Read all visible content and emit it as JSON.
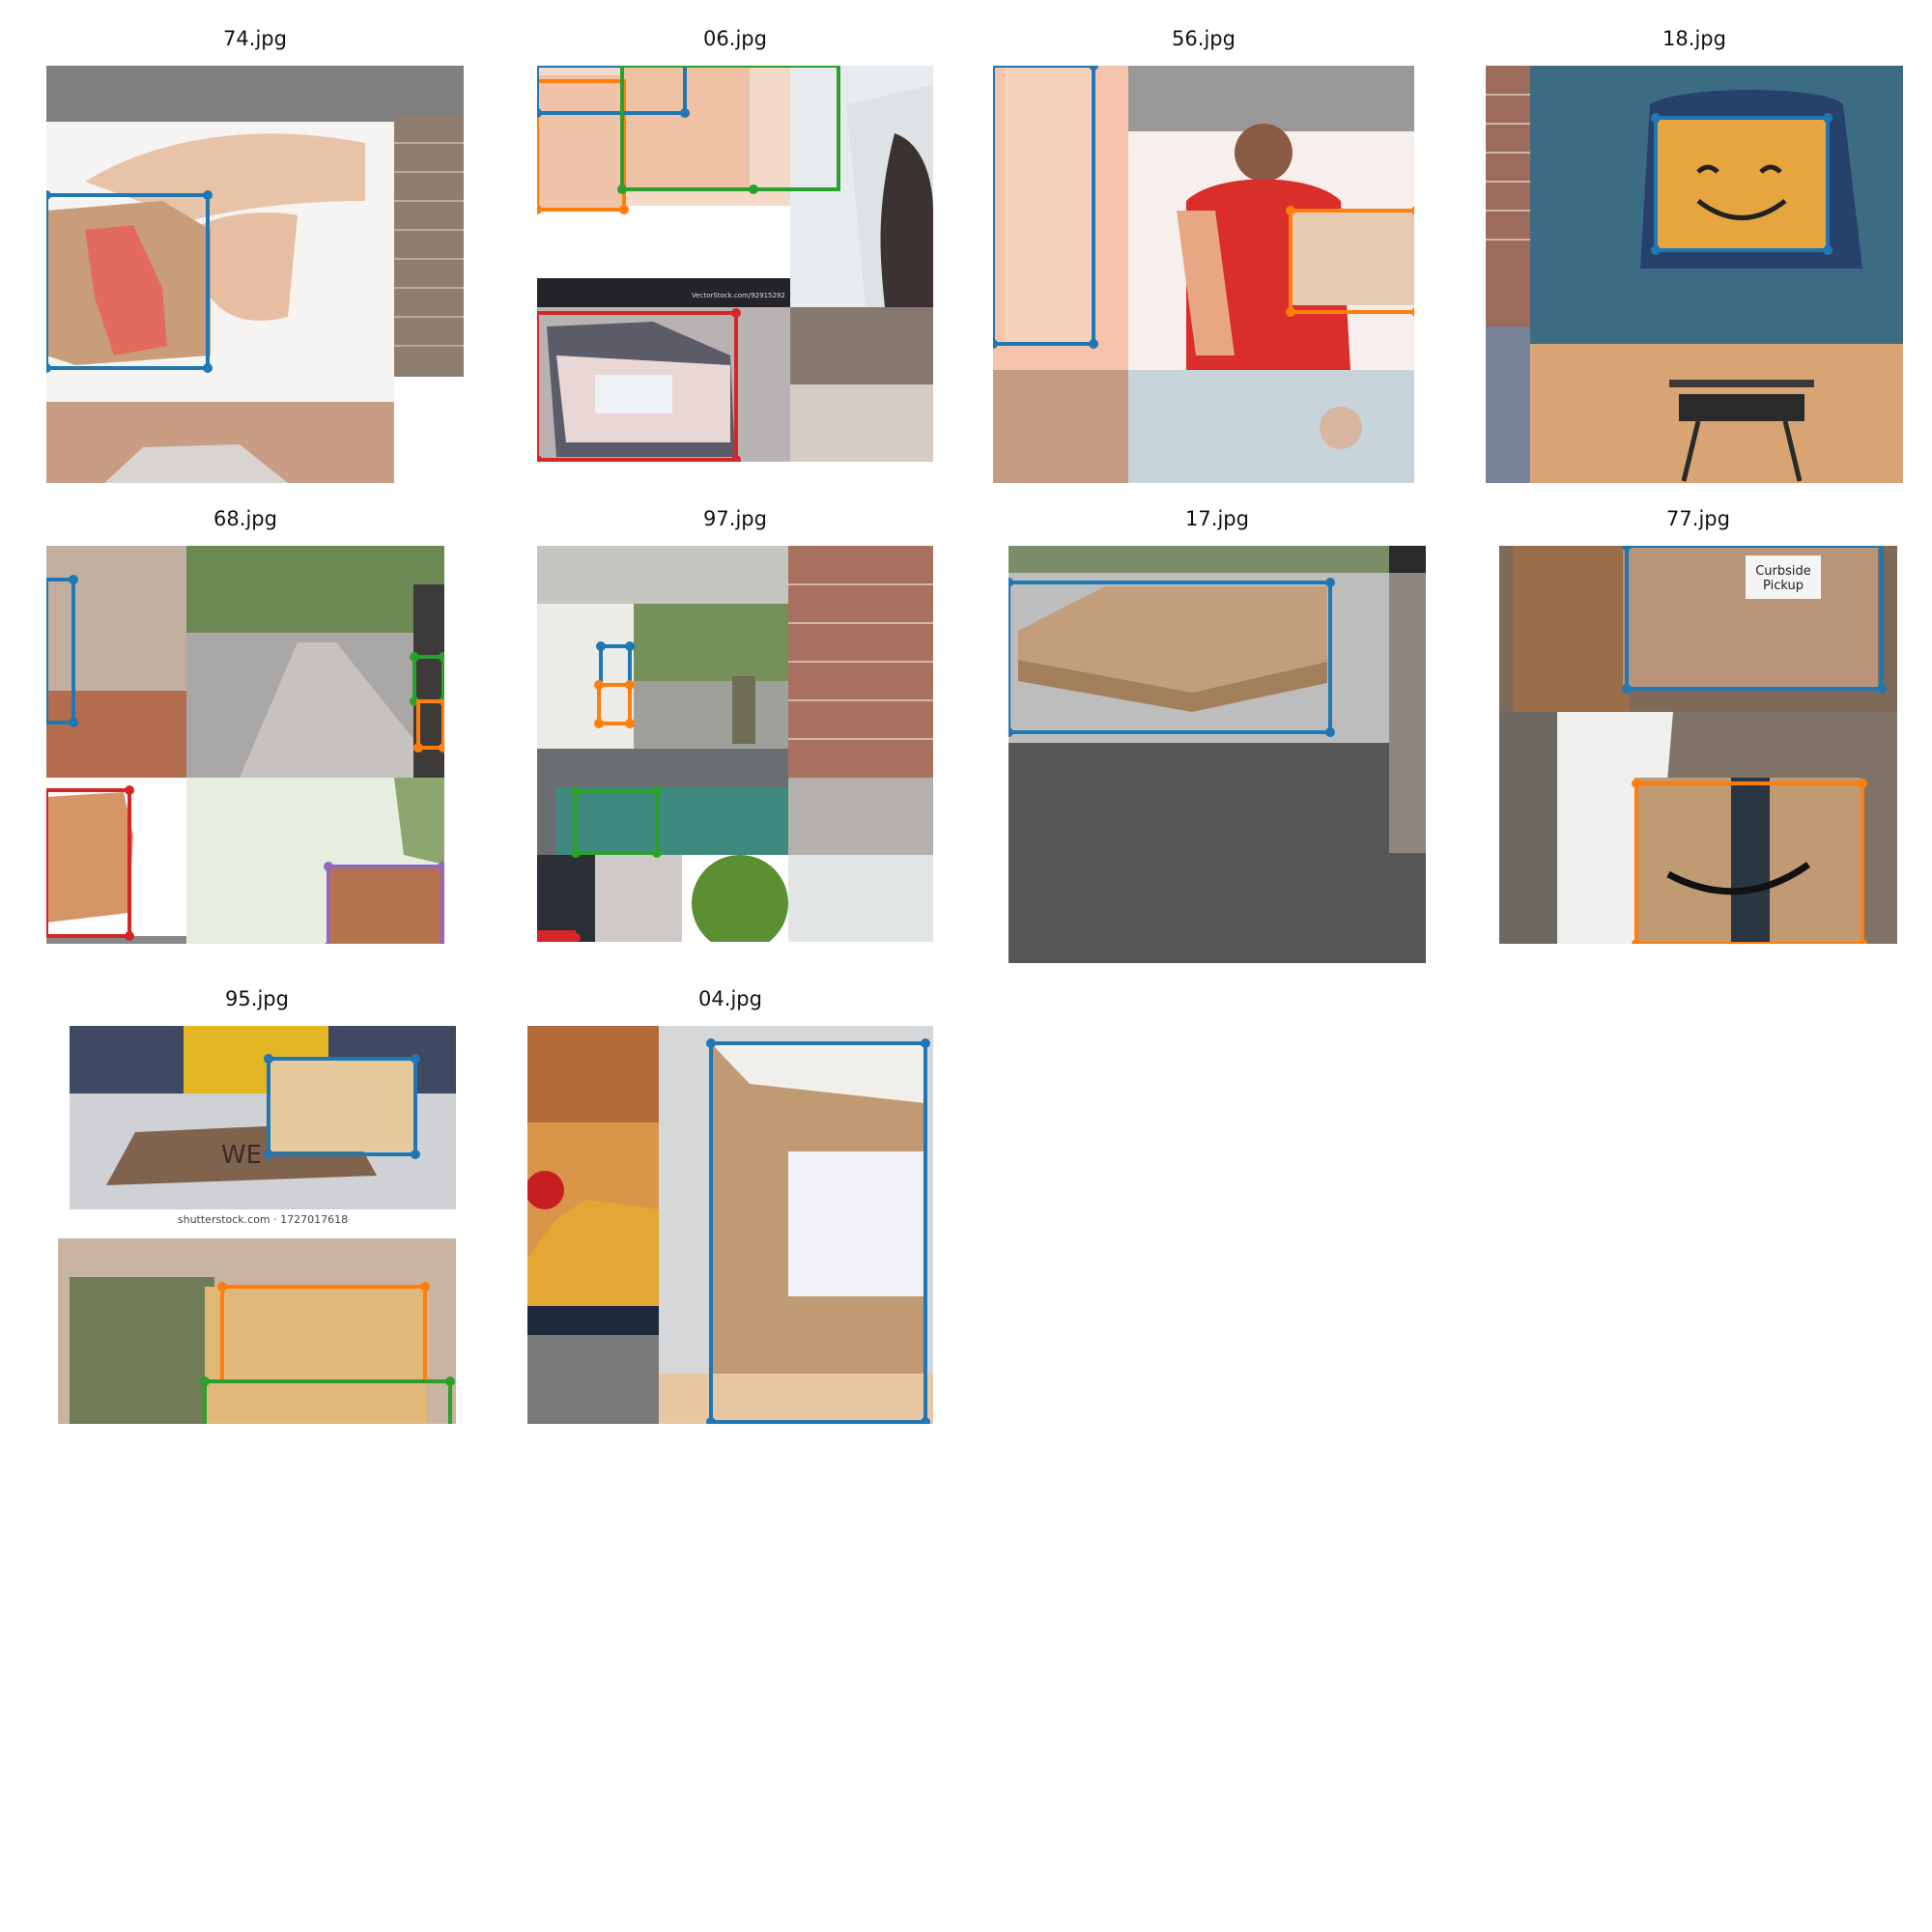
{
  "figure": {
    "tiles": [
      {
        "id": "t0",
        "title": "74.jpg"
      },
      {
        "id": "t1",
        "title": "06.jpg"
      },
      {
        "id": "t2",
        "title": "56.jpg"
      },
      {
        "id": "t3",
        "title": "18.jpg"
      },
      {
        "id": "t4",
        "title": "68.jpg"
      },
      {
        "id": "t5",
        "title": "97.jpg"
      },
      {
        "id": "t6",
        "title": "17.jpg"
      },
      {
        "id": "t7",
        "title": "77.jpg"
      },
      {
        "id": "t8",
        "title": "95.jpg"
      },
      {
        "id": "t9",
        "title": "04.jpg"
      }
    ],
    "overlay_text": {
      "t1_watermark": "VectorStock.com/92915292",
      "t7_sign": [
        "Curbside",
        "Pickup"
      ],
      "t8_watermark": "shutterstock.com · 1727017618",
      "t8_mat": "WE"
    },
    "box_colors": {
      "blue": "#1f77b4",
      "orange": "#ff7f0e",
      "green": "#2ca02c",
      "red": "#d62728",
      "purple": "#9467bd"
    }
  }
}
